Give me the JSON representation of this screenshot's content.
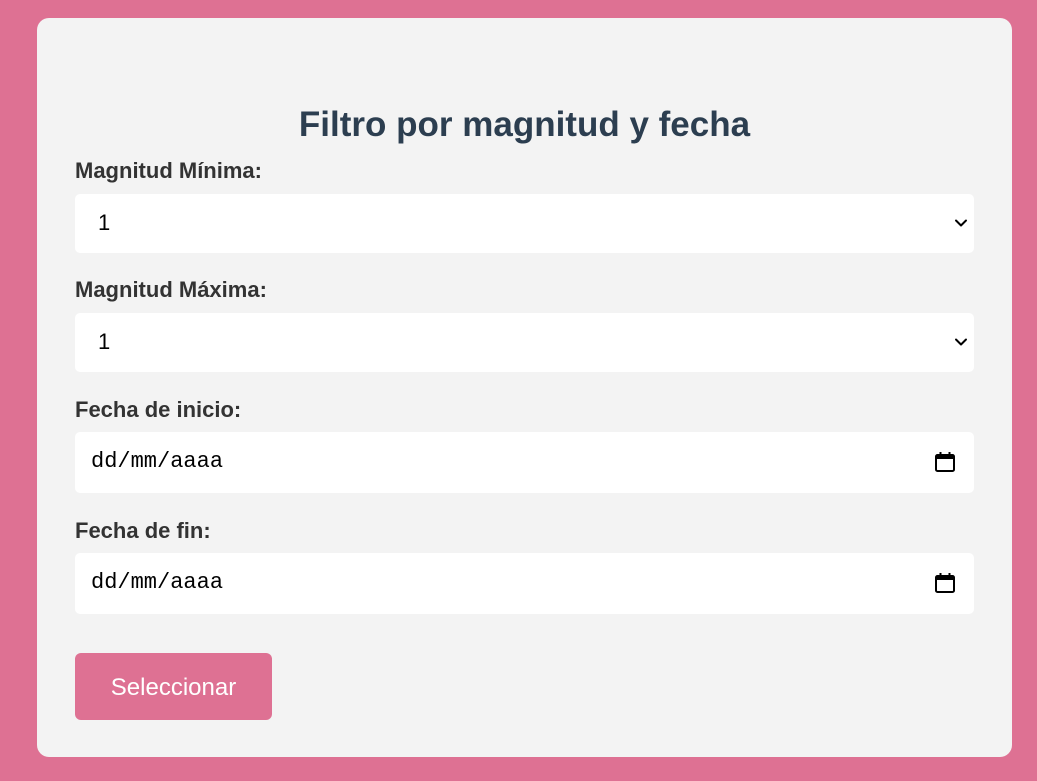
{
  "form": {
    "title": "Filtro por magnitud y fecha",
    "min_magnitude": {
      "label": "Magnitud Mínima:",
      "selected_value": "1"
    },
    "max_magnitude": {
      "label": "Magnitud Máxima:",
      "selected_value": "1"
    },
    "start_date": {
      "label": "Fecha de inicio:",
      "placeholder": "dd/mm/aaaa"
    },
    "end_date": {
      "label": "Fecha de fin:",
      "placeholder": "dd/mm/aaaa"
    },
    "submit_label": "Seleccionar"
  },
  "colors": {
    "background": "#de7193",
    "card": "#f3f3f3",
    "title": "#2c3e50",
    "label": "#333333",
    "button": "#de7193",
    "button_text": "#ffffff"
  },
  "icons": {
    "select_arrow": "chevron-down-icon",
    "date_picker": "calendar-icon"
  }
}
